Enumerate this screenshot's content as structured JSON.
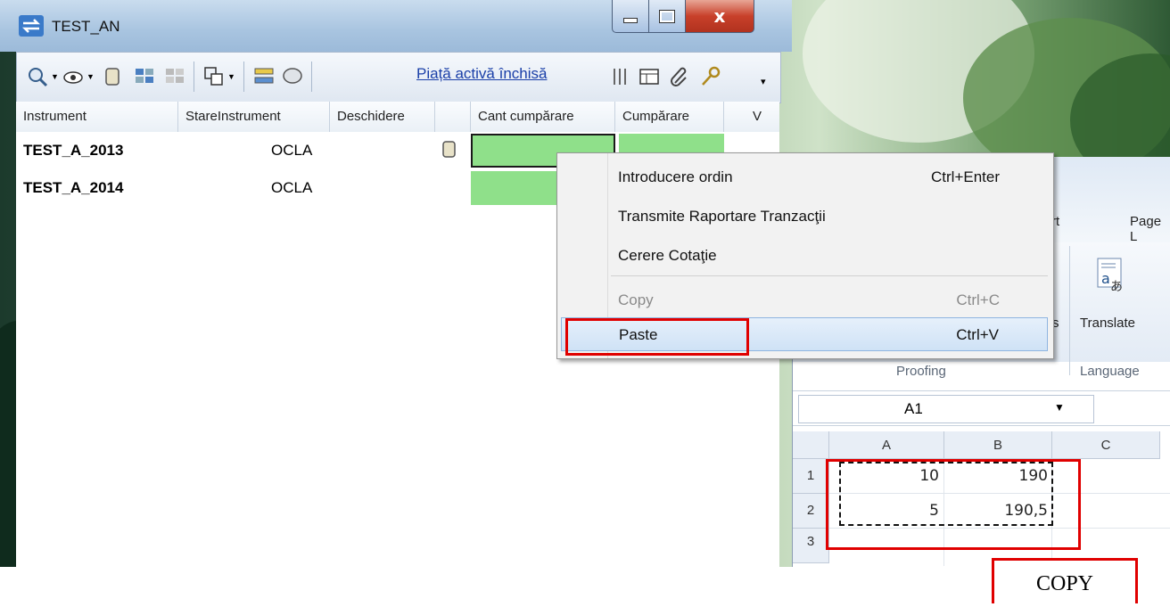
{
  "window": {
    "title": "TEST_AN",
    "icon": "exchange-arrows-icon"
  },
  "title_buttons": {
    "minimize": "minimize-icon",
    "maximize": "maximize-icon",
    "close": "close-icon"
  },
  "toolbar": {
    "link": "Piață activă închisă",
    "icons": [
      "magnifier-icon",
      "eye-icon",
      "book-icon",
      "settings-icon",
      "settings-disabled-icon",
      "refresh-icon",
      "chart-icon",
      "comment-icon",
      "columns-icon",
      "table-icon",
      "paperclip-icon",
      "key-icon"
    ]
  },
  "table": {
    "headers": [
      "Instrument",
      "StareInstrument",
      "Deschidere",
      "",
      "Cant cumpărare",
      "Cumpărare",
      "V"
    ],
    "rows": [
      {
        "instrument": "TEST_A_2013",
        "stare": "OCLA"
      },
      {
        "instrument": "TEST_A_2014",
        "stare": "OCLA"
      }
    ]
  },
  "context_menu": {
    "items": [
      {
        "label": "Introducere ordin",
        "shortcut": "Ctrl+Enter",
        "enabled": true
      },
      {
        "label": "Transmite Raportare Tranzacţii",
        "shortcut": "",
        "enabled": true
      },
      {
        "label": "Cerere Cotaţie",
        "shortcut": "",
        "enabled": true
      },
      {
        "label": "Copy",
        "shortcut": "Ctrl+C",
        "enabled": false
      },
      {
        "label": "Paste",
        "shortcut": "Ctrl+V",
        "enabled": true,
        "highlighted": true
      }
    ]
  },
  "excel": {
    "tabs": [
      "rt",
      "Page L"
    ],
    "ribbon_buttons": {
      "translate": "Translate",
      "partial": "s"
    },
    "groups": {
      "proofing": "Proofing",
      "language": "Language"
    },
    "name_box": "A1",
    "columns": [
      "A",
      "B",
      "C"
    ],
    "rows": [
      "1",
      "2",
      "3"
    ],
    "cells": [
      [
        "10",
        "190"
      ],
      [
        "5",
        "190,5"
      ]
    ]
  },
  "annotation": {
    "label": "COPY",
    "color": "#e00000"
  }
}
